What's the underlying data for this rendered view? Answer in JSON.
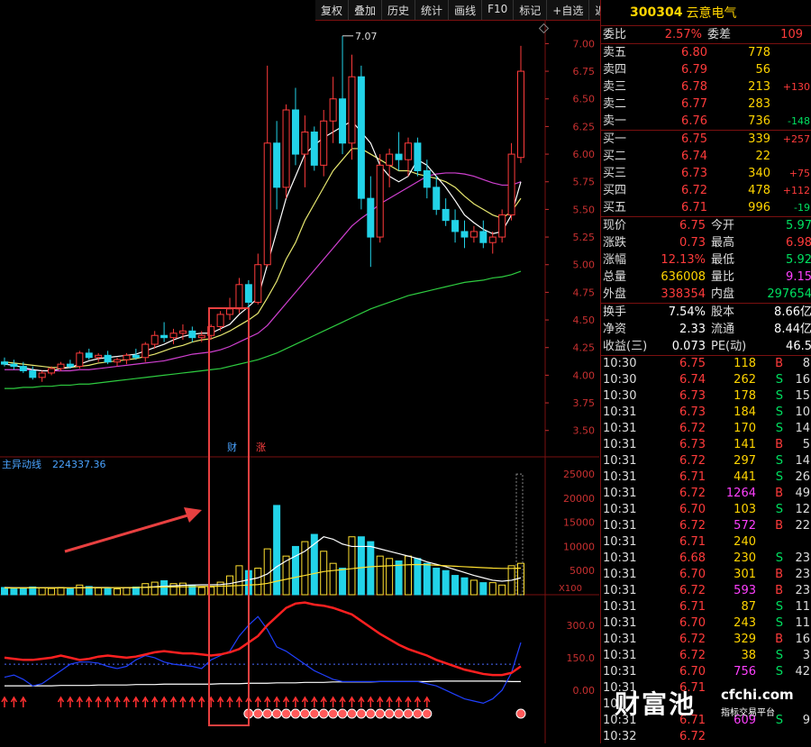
{
  "toolbar": [
    "复权",
    "叠加",
    "历史",
    "统计",
    "画线",
    "F10",
    "标记",
    "+自选",
    "返回"
  ],
  "stock": {
    "code": "300304",
    "name": "云意电气"
  },
  "weibi": {
    "label1": "委比",
    "value1": "2.57%",
    "label2": "委差",
    "value2": "109"
  },
  "asks": [
    {
      "label": "卖五",
      "price": "6.80",
      "vol": "778",
      "chg": ""
    },
    {
      "label": "卖四",
      "price": "6.79",
      "vol": "56",
      "chg": ""
    },
    {
      "label": "卖三",
      "price": "6.78",
      "vol": "213",
      "chg": "+130"
    },
    {
      "label": "卖二",
      "price": "6.77",
      "vol": "283",
      "chg": ""
    },
    {
      "label": "卖一",
      "price": "6.76",
      "vol": "736",
      "chg": "-148"
    }
  ],
  "bids": [
    {
      "label": "买一",
      "price": "6.75",
      "vol": "339",
      "chg": "+257"
    },
    {
      "label": "买二",
      "price": "6.74",
      "vol": "22",
      "chg": ""
    },
    {
      "label": "买三",
      "price": "6.73",
      "vol": "340",
      "chg": "+75"
    },
    {
      "label": "买四",
      "price": "6.72",
      "vol": "478",
      "chg": "+112"
    },
    {
      "label": "买五",
      "price": "6.71",
      "vol": "996",
      "chg": "-19"
    }
  ],
  "quote": [
    {
      "k1": "现价",
      "v1": "6.75",
      "k2": "今开",
      "v2": "5.97"
    },
    {
      "k1": "涨跌",
      "v1": "0.73",
      "k2": "最高",
      "v2": "6.98"
    },
    {
      "k1": "涨幅",
      "v1": "12.13%",
      "k2": "最低",
      "v2": "5.92"
    },
    {
      "k1": "总量",
      "v1": "636008",
      "k2": "量比",
      "v2": "9.15"
    },
    {
      "k1": "外盘",
      "v1": "338354",
      "k2": "内盘",
      "v2": "297654"
    }
  ],
  "fundamentals": [
    {
      "k1": "换手",
      "v1": "7.54%",
      "k2": "股本",
      "v2": "8.66亿"
    },
    {
      "k1": "净资",
      "v1": "2.33",
      "k2": "流通",
      "v2": "8.44亿"
    },
    {
      "k1": "收益(三)",
      "v1": "0.073",
      "k2": "PE(动)",
      "v2": "46.5"
    }
  ],
  "ticks": [
    {
      "time": "10:30",
      "price": "6.75",
      "vol": "118",
      "dir": "B",
      "n": "8"
    },
    {
      "time": "10:30",
      "price": "6.74",
      "vol": "262",
      "dir": "S",
      "n": "16"
    },
    {
      "time": "10:30",
      "price": "6.73",
      "vol": "178",
      "dir": "S",
      "n": "15"
    },
    {
      "time": "10:31",
      "price": "6.73",
      "vol": "184",
      "dir": "S",
      "n": "10"
    },
    {
      "time": "10:31",
      "price": "6.72",
      "vol": "170",
      "dir": "S",
      "n": "14"
    },
    {
      "time": "10:31",
      "price": "6.73",
      "vol": "141",
      "dir": "B",
      "n": "5"
    },
    {
      "time": "10:31",
      "price": "6.72",
      "vol": "297",
      "dir": "S",
      "n": "14"
    },
    {
      "time": "10:31",
      "price": "6.71",
      "vol": "441",
      "dir": "S",
      "n": "26"
    },
    {
      "time": "10:31",
      "price": "6.72",
      "vol": "1264",
      "dir": "B",
      "n": "49"
    },
    {
      "time": "10:31",
      "price": "6.70",
      "vol": "103",
      "dir": "S",
      "n": "12"
    },
    {
      "time": "10:31",
      "price": "6.72",
      "vol": "572",
      "dir": "B",
      "n": "22"
    },
    {
      "time": "10:31",
      "price": "6.71",
      "vol": "240",
      "dir": "",
      "n": ""
    },
    {
      "time": "10:31",
      "price": "6.68",
      "vol": "230",
      "dir": "S",
      "n": "23"
    },
    {
      "time": "10:31",
      "price": "6.70",
      "vol": "301",
      "dir": "B",
      "n": "23"
    },
    {
      "time": "10:31",
      "price": "6.72",
      "vol": "593",
      "dir": "B",
      "n": "23"
    },
    {
      "time": "10:31",
      "price": "6.71",
      "vol": "87",
      "dir": "S",
      "n": "11"
    },
    {
      "time": "10:31",
      "price": "6.70",
      "vol": "243",
      "dir": "S",
      "n": "11"
    },
    {
      "time": "10:31",
      "price": "6.72",
      "vol": "329",
      "dir": "B",
      "n": "16"
    },
    {
      "time": "10:31",
      "price": "6.72",
      "vol": "38",
      "dir": "S",
      "n": "3"
    },
    {
      "time": "10:31",
      "price": "6.70",
      "vol": "756",
      "dir": "S",
      "n": "42"
    },
    {
      "time": "10:31",
      "price": "6.71",
      "vol": "",
      "dir": "",
      "n": ""
    },
    {
      "time": "10",
      "price": "",
      "vol": "",
      "dir": "",
      "n": ""
    },
    {
      "time": "10:31",
      "price": "6.71",
      "vol": "609",
      "dir": "S",
      "n": "9"
    },
    {
      "time": "10:32",
      "price": "6.72",
      "vol": "",
      "dir": "",
      "n": ""
    }
  ],
  "chart_data": {
    "type": "candlestick",
    "price_axis": {
      "ticks": [
        "7.00",
        "6.75",
        "6.50",
        "6.25",
        "6.00",
        "5.75",
        "5.50",
        "5.25",
        "5.00",
        "4.75",
        "4.50",
        "4.25",
        "4.00",
        "3.75",
        "3.50"
      ],
      "range": [
        3.4,
        7.15
      ]
    },
    "high_label": "7.07",
    "volume_label": "主异动线",
    "volume_value": "224337.36",
    "volume_axis": {
      "ticks": [
        "25000",
        "20000",
        "15000",
        "10000",
        "5000"
      ],
      "unit": "X100"
    },
    "indicator_axis": {
      "ticks": [
        "300.0",
        "150.0",
        "0.00"
      ]
    },
    "markers": [
      "财",
      "涨"
    ],
    "candles": [
      [
        4.12,
        4.16,
        4.08,
        4.1
      ],
      [
        4.1,
        4.14,
        4.05,
        4.08
      ],
      [
        4.08,
        4.12,
        4.02,
        4.04
      ],
      [
        4.04,
        4.08,
        3.96,
        3.98
      ],
      [
        3.98,
        4.04,
        3.94,
        4.02
      ],
      [
        4.02,
        4.08,
        4.0,
        4.06
      ],
      [
        4.06,
        4.12,
        4.04,
        4.1
      ],
      [
        4.1,
        4.14,
        4.06,
        4.08
      ],
      [
        4.08,
        4.22,
        4.06,
        4.2
      ],
      [
        4.2,
        4.24,
        4.14,
        4.16
      ],
      [
        4.16,
        4.2,
        4.12,
        4.18
      ],
      [
        4.18,
        4.22,
        4.1,
        4.12
      ],
      [
        4.12,
        4.16,
        4.08,
        4.14
      ],
      [
        4.14,
        4.2,
        4.1,
        4.18
      ],
      [
        4.18,
        4.24,
        4.14,
        4.16
      ],
      [
        4.16,
        4.3,
        4.12,
        4.28
      ],
      [
        4.28,
        4.4,
        4.24,
        4.36
      ],
      [
        4.36,
        4.48,
        4.3,
        4.34
      ],
      [
        4.34,
        4.42,
        4.28,
        4.38
      ],
      [
        4.38,
        4.46,
        4.32,
        4.4
      ],
      [
        4.4,
        4.44,
        4.3,
        4.34
      ],
      [
        4.34,
        4.4,
        4.3,
        4.36
      ],
      [
        4.36,
        4.46,
        4.32,
        4.44
      ],
      [
        4.44,
        4.58,
        4.4,
        4.55
      ],
      [
        4.55,
        4.7,
        4.5,
        4.6
      ],
      [
        4.6,
        4.88,
        4.56,
        4.82
      ],
      [
        4.82,
        4.86,
        4.6,
        4.66
      ],
      [
        4.66,
        5.1,
        4.64,
        5.0
      ],
      [
        5.0,
        6.8,
        4.98,
        6.1
      ],
      [
        6.1,
        6.3,
        5.5,
        5.7
      ],
      [
        5.7,
        6.45,
        5.6,
        6.4
      ],
      [
        6.4,
        6.6,
        5.9,
        6.0
      ],
      [
        6.0,
        6.35,
        5.7,
        6.2
      ],
      [
        6.2,
        6.25,
        5.85,
        5.9
      ],
      [
        5.9,
        6.4,
        5.8,
        6.3
      ],
      [
        6.3,
        6.7,
        6.1,
        6.5
      ],
      [
        6.5,
        7.07,
        6.0,
        6.1
      ],
      [
        6.1,
        6.9,
        5.95,
        6.7
      ],
      [
        6.7,
        6.8,
        5.5,
        5.6
      ],
      [
        5.6,
        5.8,
        4.98,
        5.25
      ],
      [
        5.25,
        6.0,
        5.2,
        5.9
      ],
      [
        5.9,
        6.05,
        5.7,
        6.0
      ],
      [
        6.0,
        6.2,
        5.85,
        5.95
      ],
      [
        5.95,
        6.15,
        5.8,
        6.1
      ],
      [
        6.1,
        6.15,
        5.8,
        5.85
      ],
      [
        5.85,
        5.95,
        5.6,
        5.7
      ],
      [
        5.7,
        5.8,
        5.45,
        5.5
      ],
      [
        5.5,
        5.6,
        5.35,
        5.4
      ],
      [
        5.4,
        5.5,
        5.2,
        5.3
      ],
      [
        5.3,
        5.4,
        5.15,
        5.25
      ],
      [
        5.25,
        5.35,
        5.2,
        5.3
      ],
      [
        5.3,
        5.4,
        5.15,
        5.2
      ],
      [
        5.2,
        5.3,
        5.1,
        5.25
      ],
      [
        5.25,
        5.5,
        5.2,
        5.45
      ],
      [
        5.45,
        6.1,
        5.4,
        6.0
      ],
      [
        5.97,
        6.98,
        5.92,
        6.75
      ]
    ],
    "ma5": [
      4.1,
      4.09,
      4.07,
      4.05,
      4.04,
      4.04,
      4.06,
      4.07,
      4.1,
      4.13,
      4.15,
      4.16,
      4.17,
      4.18,
      4.19,
      4.22,
      4.25,
      4.28,
      4.32,
      4.35,
      4.37,
      4.38,
      4.38,
      4.42,
      4.46,
      4.55,
      4.62,
      4.7,
      5.0,
      5.3,
      5.6,
      5.8,
      6.0,
      6.08,
      6.15,
      6.2,
      6.25,
      6.3,
      6.2,
      6.1,
      5.9,
      5.8,
      5.75,
      5.8,
      5.95,
      5.9,
      5.8,
      5.7,
      5.58,
      5.45,
      5.38,
      5.32,
      5.28,
      5.3,
      5.45,
      5.75
    ],
    "ma10": [
      4.12,
      4.11,
      4.1,
      4.09,
      4.08,
      4.07,
      4.07,
      4.07,
      4.08,
      4.09,
      4.11,
      4.12,
      4.13,
      4.14,
      4.15,
      4.17,
      4.19,
      4.22,
      4.25,
      4.27,
      4.3,
      4.32,
      4.33,
      4.36,
      4.4,
      4.45,
      4.5,
      4.56,
      4.7,
      4.85,
      5.05,
      5.2,
      5.4,
      5.55,
      5.7,
      5.85,
      5.95,
      6.05,
      6.05,
      6.0,
      5.95,
      5.9,
      5.85,
      5.85,
      5.82,
      5.8,
      5.78,
      5.75,
      5.7,
      5.62,
      5.55,
      5.5,
      5.45,
      5.42,
      5.48,
      5.6
    ],
    "ma20": [
      4.05,
      4.05,
      4.05,
      4.05,
      4.04,
      4.04,
      4.04,
      4.04,
      4.05,
      4.05,
      4.06,
      4.07,
      4.08,
      4.09,
      4.1,
      4.11,
      4.12,
      4.13,
      4.15,
      4.17,
      4.19,
      4.2,
      4.21,
      4.23,
      4.26,
      4.3,
      4.34,
      4.38,
      4.45,
      4.55,
      4.65,
      4.75,
      4.85,
      4.95,
      5.05,
      5.15,
      5.25,
      5.35,
      5.42,
      5.48,
      5.55,
      5.6,
      5.65,
      5.7,
      5.75,
      5.8,
      5.82,
      5.83,
      5.83,
      5.82,
      5.8,
      5.77,
      5.74,
      5.72,
      5.72,
      5.75
    ],
    "ma60": [
      3.88,
      3.88,
      3.89,
      3.89,
      3.9,
      3.9,
      3.91,
      3.91,
      3.92,
      3.92,
      3.93,
      3.94,
      3.95,
      3.96,
      3.97,
      3.98,
      3.99,
      4.0,
      4.01,
      4.02,
      4.03,
      4.04,
      4.05,
      4.06,
      4.08,
      4.1,
      4.12,
      4.14,
      4.17,
      4.2,
      4.24,
      4.28,
      4.32,
      4.36,
      4.4,
      4.44,
      4.48,
      4.52,
      4.56,
      4.6,
      4.63,
      4.66,
      4.69,
      4.72,
      4.74,
      4.76,
      4.78,
      4.8,
      4.82,
      4.84,
      4.85,
      4.86,
      4.88,
      4.89,
      4.91,
      4.94
    ],
    "volumes": [
      1500,
      1200,
      1300,
      1600,
      1400,
      1300,
      1500,
      1200,
      2000,
      1700,
      1400,
      1300,
      1200,
      1500,
      1600,
      2300,
      2600,
      2900,
      2300,
      2400,
      2000,
      1500,
      1600,
      2600,
      3900,
      6000,
      5000,
      5500,
      9500,
      18500,
      8000,
      10000,
      11000,
      12500,
      9000,
      6500,
      5500,
      12000,
      12000,
      11000,
      8000,
      7500,
      7000,
      8000,
      7500,
      6500,
      5500,
      5000,
      4000,
      3500,
      3000,
      2500,
      2500,
      2000,
      6000,
      6500
    ],
    "vol_ma1": [
      1500,
      1450,
      1450,
      1450,
      1450,
      1450,
      1450,
      1400,
      1450,
      1500,
      1500,
      1500,
      1450,
      1450,
      1450,
      1550,
      1650,
      1750,
      1850,
      1950,
      2000,
      2050,
      2050,
      2100,
      2300,
      2700,
      3100,
      3500,
      4300,
      5800,
      7000,
      8000,
      9000,
      10500,
      12000,
      11500,
      10500,
      10000,
      10000,
      10000,
      9500,
      9000,
      8500,
      8000,
      7500,
      6800,
      6300,
      5800,
      5200,
      4600,
      4000,
      3500,
      3000,
      2800,
      3000,
      3500
    ],
    "vol_ma2": [
      1400,
      1400,
      1400,
      1420,
      1420,
      1420,
      1420,
      1420,
      1430,
      1440,
      1450,
      1460,
      1470,
      1480,
      1500,
      1520,
      1550,
      1580,
      1610,
      1640,
      1670,
      1700,
      1720,
      1760,
      1820,
      1900,
      2000,
      2100,
      2350,
      2800,
      3200,
      3600,
      4000,
      4400,
      4800,
      5000,
      5200,
      5400,
      5600,
      5800,
      5900,
      6000,
      6100,
      6200,
      6250,
      6200,
      6100,
      6000,
      5900,
      5800,
      5700,
      5600,
      5500,
      5450,
      5450,
      5500
    ],
    "ind_red": [
      150,
      145,
      140,
      140,
      145,
      150,
      160,
      150,
      140,
      145,
      155,
      160,
      155,
      150,
      155,
      165,
      175,
      180,
      175,
      170,
      170,
      165,
      160,
      165,
      175,
      190,
      220,
      250,
      300,
      340,
      380,
      400,
      405,
      395,
      390,
      380,
      365,
      350,
      320,
      290,
      260,
      235,
      210,
      190,
      175,
      160,
      140,
      125,
      110,
      95,
      85,
      75,
      70,
      70,
      80,
      110
    ],
    "ind_blue": [
      60,
      70,
      50,
      20,
      30,
      60,
      90,
      120,
      130,
      130,
      125,
      110,
      100,
      110,
      140,
      160,
      150,
      130,
      120,
      115,
      110,
      100,
      140,
      160,
      180,
      250,
      300,
      340,
      280,
      200,
      180,
      150,
      120,
      90,
      70,
      50,
      40,
      40,
      40,
      40,
      40,
      40,
      40,
      40,
      40,
      30,
      20,
      0,
      -20,
      -40,
      -50,
      -60,
      -40,
      0,
      80,
      220
    ],
    "ind_white": [
      20,
      20,
      20,
      20,
      20,
      20,
      22,
      22,
      22,
      22,
      24,
      24,
      24,
      24,
      26,
      26,
      26,
      28,
      28,
      28,
      28,
      28,
      28,
      30,
      30,
      30,
      32,
      32,
      32,
      34,
      34,
      34,
      36,
      36,
      36,
      38,
      38,
      38,
      38,
      38,
      40,
      40,
      40,
      40,
      40,
      40,
      42,
      42,
      42,
      42,
      42,
      42,
      42,
      42,
      40,
      40
    ],
    "ind_dots": [
      120,
      120,
      120,
      120,
      120,
      120,
      120,
      120,
      120,
      120,
      120,
      120,
      120,
      120,
      120,
      120,
      120,
      120,
      120,
      120,
      120,
      120,
      120,
      120,
      120,
      120,
      120,
      120,
      120,
      120,
      120,
      120,
      120,
      120,
      120,
      120,
      120,
      120,
      120,
      120,
      120,
      120,
      120,
      120,
      120,
      120,
      120,
      120,
      120,
      120,
      120,
      120,
      120,
      120,
      120,
      120
    ]
  },
  "watermark": {
    "brand": "财富池",
    "site": "cfchi.com",
    "slogan": "指标交易平台"
  }
}
